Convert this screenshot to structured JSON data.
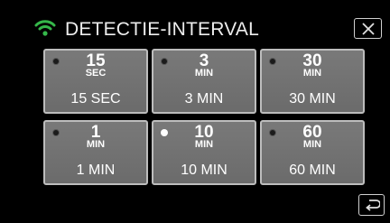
{
  "header": {
    "title": "DETECTIE-INTERVAL",
    "status_icon": "wifi-icon",
    "close_icon": "close-icon"
  },
  "colors": {
    "wifi_icon": "#35b84a",
    "tile_bg": "#737373",
    "tile_border": "#bdbdbd",
    "selected_indicator": "#ffffff"
  },
  "options": [
    {
      "value": "15",
      "unit": "SEC",
      "label": "15 SEC",
      "selected": false
    },
    {
      "value": "3",
      "unit": "MIN",
      "label": "3 MIN",
      "selected": false
    },
    {
      "value": "30",
      "unit": "MIN",
      "label": "30 MIN",
      "selected": false
    },
    {
      "value": "1",
      "unit": "MIN",
      "label": "1 MIN",
      "selected": false
    },
    {
      "value": "10",
      "unit": "MIN",
      "label": "10 MIN",
      "selected": true
    },
    {
      "value": "60",
      "unit": "MIN",
      "label": "60 MIN",
      "selected": false
    }
  ],
  "footer": {
    "back_icon": "return-icon"
  }
}
